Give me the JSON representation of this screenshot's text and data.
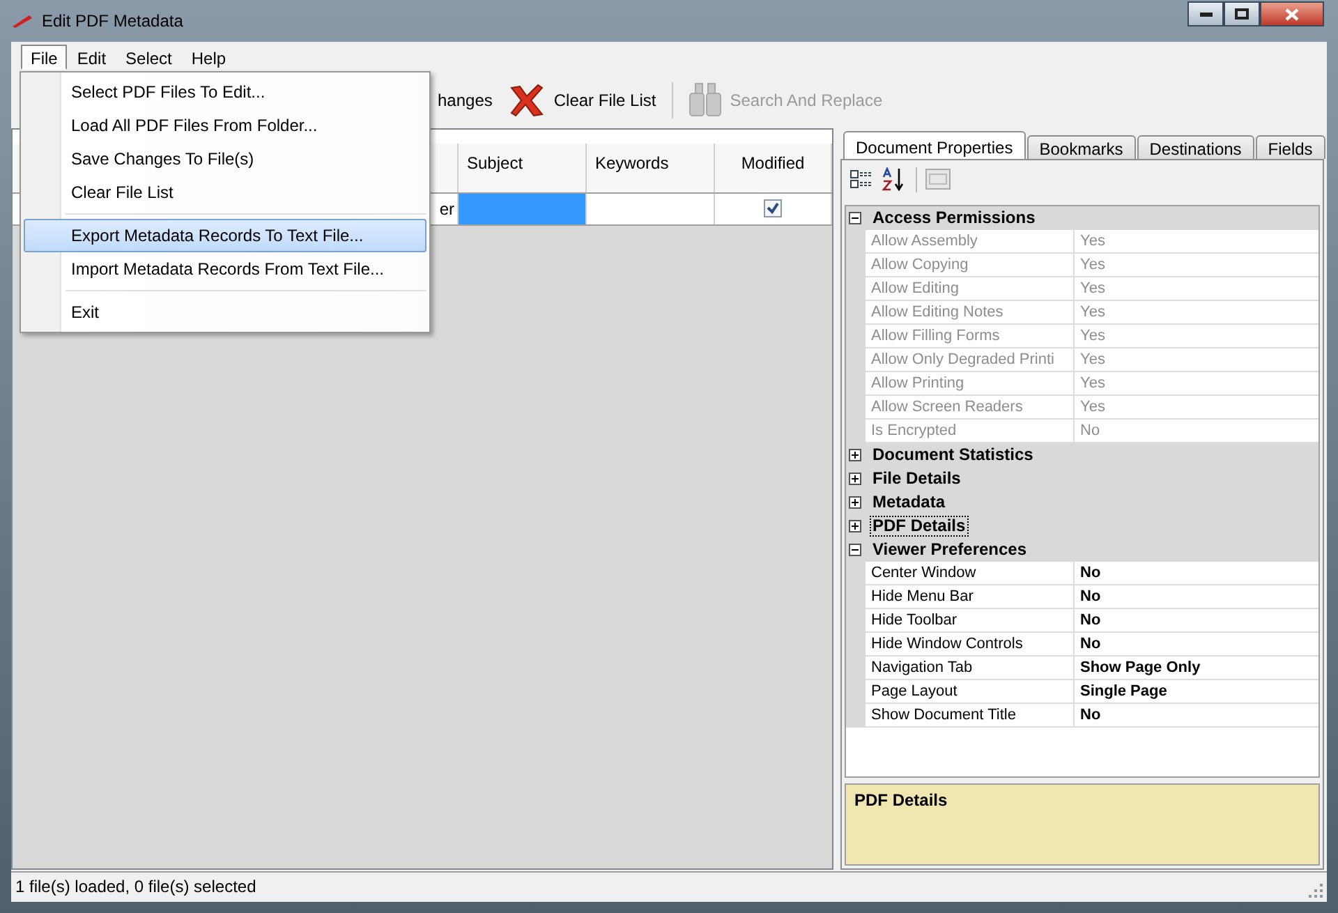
{
  "window": {
    "title": "Edit PDF Metadata"
  },
  "menu_bar": [
    {
      "label": "File",
      "selected": true
    },
    {
      "label": "Edit",
      "selected": false
    },
    {
      "label": "Select",
      "selected": false
    },
    {
      "label": "Help",
      "selected": false
    }
  ],
  "file_menu": [
    {
      "kind": "item",
      "label": "Select PDF Files To Edit...",
      "selected": false
    },
    {
      "kind": "item",
      "label": "Load All PDF Files From Folder...",
      "selected": false
    },
    {
      "kind": "item",
      "label": "Save Changes To File(s)",
      "selected": false
    },
    {
      "kind": "item",
      "label": "Clear File List",
      "selected": false
    },
    {
      "kind": "separator"
    },
    {
      "kind": "item",
      "label": "Export Metadata Records To Text File...",
      "selected": true
    },
    {
      "kind": "item",
      "label": "Import Metadata Records From Text File...",
      "selected": false
    },
    {
      "kind": "separator"
    },
    {
      "kind": "item",
      "label": "Exit",
      "selected": false
    }
  ],
  "toolbar": [
    {
      "kind": "text",
      "label": "hanges",
      "disabled": false
    },
    {
      "kind": "clear",
      "label": "Clear File List",
      "disabled": false
    },
    {
      "kind": "separator"
    },
    {
      "kind": "search",
      "label": "Search And Replace",
      "disabled": true
    }
  ],
  "table": {
    "columns": [
      "Subject",
      "Keywords",
      "Modified"
    ],
    "rows": [
      {
        "column_1": "er",
        "subject_selected": true,
        "modified": true
      }
    ]
  },
  "tabs": [
    {
      "label": "Document Properties",
      "selected": true
    },
    {
      "label": "Bookmarks",
      "selected": false
    },
    {
      "label": "Destinations",
      "selected": false
    },
    {
      "label": "Fields",
      "selected": false
    }
  ],
  "property_grid": [
    {
      "name": "Access Permissions",
      "expanded": true,
      "selected": false,
      "items": [
        {
          "name": "Allow Assembly",
          "value": "Yes",
          "readonly": true
        },
        {
          "name": "Allow Copying",
          "value": "Yes",
          "readonly": true
        },
        {
          "name": "Allow Editing",
          "value": "Yes",
          "readonly": true
        },
        {
          "name": "Allow Editing Notes",
          "value": "Yes",
          "readonly": true
        },
        {
          "name": "Allow Filling Forms",
          "value": "Yes",
          "readonly": true
        },
        {
          "name": "Allow Only Degraded Printi",
          "value": "Yes",
          "readonly": true
        },
        {
          "name": "Allow Printing",
          "value": "Yes",
          "readonly": true
        },
        {
          "name": "Allow Screen Readers",
          "value": "Yes",
          "readonly": true
        },
        {
          "name": "Is Encrypted",
          "value": "No",
          "readonly": true
        }
      ]
    },
    {
      "name": "Document Statistics",
      "expanded": false,
      "selected": false
    },
    {
      "name": "File Details",
      "expanded": false,
      "selected": false
    },
    {
      "name": "Metadata",
      "expanded": false,
      "selected": false
    },
    {
      "name": "PDF Details",
      "expanded": false,
      "selected": true
    },
    {
      "name": "Viewer Preferences",
      "expanded": true,
      "selected": false,
      "items": [
        {
          "name": "Center Window",
          "value": "No",
          "readonly": false
        },
        {
          "name": "Hide Menu Bar",
          "value": "No",
          "readonly": false
        },
        {
          "name": "Hide Toolbar",
          "value": "No",
          "readonly": false
        },
        {
          "name": "Hide Window Controls",
          "value": "No",
          "readonly": false
        },
        {
          "name": "Navigation Tab",
          "value": "Show Page Only",
          "readonly": false
        },
        {
          "name": "Page Layout",
          "value": "Single Page",
          "readonly": false
        },
        {
          "name": "Show Document Title",
          "value": "No",
          "readonly": false
        }
      ]
    }
  ],
  "description": {
    "title": "PDF Details"
  },
  "status_bar": "1 file(s) loaded, 0 file(s) selected"
}
